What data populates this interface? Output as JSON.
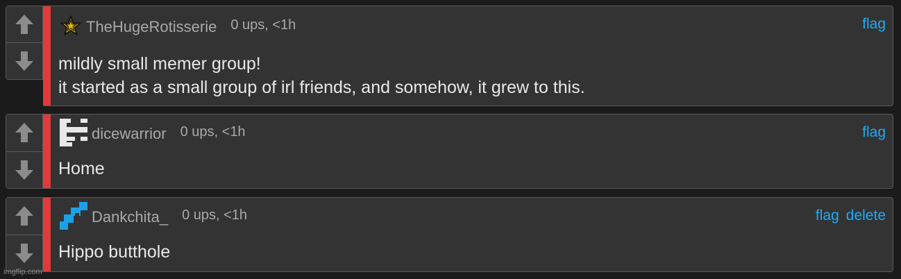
{
  "comments": [
    {
      "username": "TheHugeRotisserie",
      "meta": "0 ups, <1h",
      "avatar_icon": "star-icon",
      "lines": [
        "mildly small memer group!",
        "it started as a small group of irl friends, and somehow, it grew to this."
      ],
      "actions": [
        "flag"
      ]
    },
    {
      "username": "dicewarrior",
      "meta": "0 ups, <1h",
      "avatar_icon": "pixel-identicon-icon",
      "lines": [
        "Home"
      ],
      "actions": [
        "flag"
      ]
    },
    {
      "username": "Dankchita_",
      "meta": "0 ups, <1h",
      "avatar_icon": "pixel-identicon-blue-icon",
      "lines": [
        "Hippo butthole"
      ],
      "actions": [
        "flag",
        "delete"
      ]
    }
  ],
  "colors": {
    "accent_bar": "#e23a3a",
    "link": "#23aaf2",
    "card_bg": "#333333"
  },
  "watermark": "imgflip.com"
}
